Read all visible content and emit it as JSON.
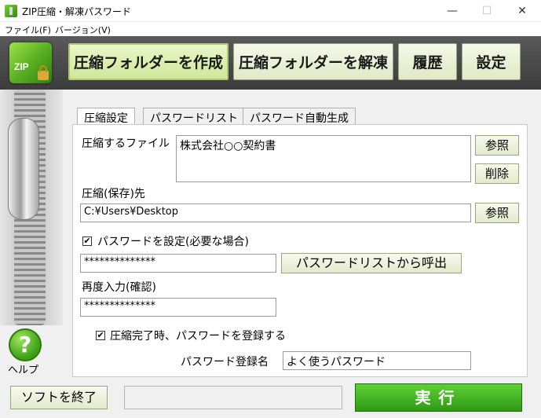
{
  "window": {
    "title": "ZIP圧縮・解凍パスワード",
    "min": "—",
    "max": "☐",
    "close": "✕"
  },
  "menu": {
    "file": "ファイル(F)",
    "version": "バージョン(V)"
  },
  "header": {
    "logo_text": "ZIP",
    "create_zip": "圧縮フォルダーを作成",
    "extract_zip": "圧縮フォルダーを解凍",
    "history": "履歴",
    "settings": "設定"
  },
  "tabs": [
    {
      "label": "圧縮設定"
    },
    {
      "label": "パスワードリスト"
    },
    {
      "label": "パスワード自動生成"
    }
  ],
  "form": {
    "file_label": "圧縮するファイル",
    "file_value": "株式会社○○契約書",
    "browse": "参照",
    "remove": "削除",
    "dest_label": "圧縮(保存)先",
    "dest_value": "C:¥Users¥Desktop",
    "dest_browse": "参照",
    "set_password_label": "パスワードを設定(必要な場合)",
    "set_password_checked": "✔",
    "password_value": "**************",
    "recall_list": "パスワードリストから呼出",
    "reenter_label": "再度入力(確認)",
    "reenter_value": "**************",
    "register_label": "圧縮完了時、パスワードを登録する",
    "register_checked": "✔",
    "reg_name_label": "パスワード登録名",
    "reg_name_value": "よく使うパスワード"
  },
  "sidebar": {
    "help_icon_text": "?",
    "help_label": "ヘルプ"
  },
  "footer": {
    "quit": "ソフトを終了",
    "status": "",
    "run": "実行"
  }
}
